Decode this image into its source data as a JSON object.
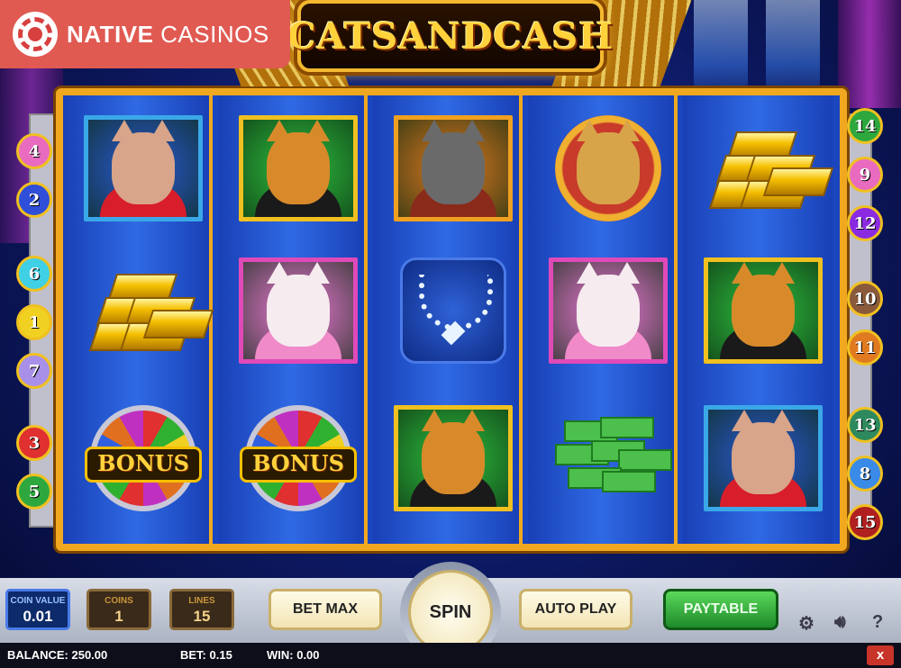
{
  "brand": {
    "prefix": "NATIVE",
    "suffix": "CASINOS"
  },
  "game_title": "CATSANDCASH",
  "reels": [
    {
      "symbols": [
        "cat-lady-red-dress",
        "gold-bars",
        "bonus-wheel"
      ]
    },
    {
      "symbols": [
        "tabby-cat-suit",
        "white-persian-cat",
        "bonus-wheel"
      ]
    },
    {
      "symbols": [
        "grey-cat-dj",
        "diamond-necklace",
        "tabby-cat-suit"
      ]
    },
    {
      "symbols": [
        "singer-cat-medallion",
        "white-persian-cat",
        "cash-stack"
      ]
    },
    {
      "symbols": [
        "gold-bars",
        "tabby-cat-suit",
        "cat-lady-red-dress"
      ]
    }
  ],
  "bonus_label": "BONUS",
  "paylines_left": [
    {
      "n": "4",
      "color": "#e96bbf"
    },
    {
      "n": "2",
      "color": "#2f4fd8"
    },
    {
      "n": "6",
      "color": "#3fd0e6"
    },
    {
      "n": "1",
      "color": "#f0d020"
    },
    {
      "n": "7",
      "color": "#a890e8"
    },
    {
      "n": "3",
      "color": "#e03030"
    },
    {
      "n": "5",
      "color": "#2ea83e"
    }
  ],
  "paylines_right": [
    {
      "n": "14",
      "color": "#2ea83e"
    },
    {
      "n": "9",
      "color": "#e96bbf"
    },
    {
      "n": "12",
      "color": "#8a2be2"
    },
    {
      "n": "10",
      "color": "#8a5a3a"
    },
    {
      "n": "11",
      "color": "#e07a20"
    },
    {
      "n": "13",
      "color": "#2e8a5e"
    },
    {
      "n": "8",
      "color": "#3a8ae8"
    },
    {
      "n": "15",
      "color": "#b02020"
    }
  ],
  "controls": {
    "coin_value": {
      "label": "COIN VALUE",
      "value": "0.01"
    },
    "coins": {
      "label": "COINS",
      "value": "1"
    },
    "lines": {
      "label": "LINES",
      "value": "15"
    },
    "bet_max": "BET MAX",
    "spin": "SPIN",
    "auto_play": "AUTO PLAY",
    "paytable": "PAYTABLE",
    "help": "?",
    "close": "x"
  },
  "status": {
    "balance": "BALANCE: 250.00",
    "bet": "BET: 0.15",
    "win": "WIN: 0.00"
  },
  "colors": {
    "frame_gold": "#f0a820",
    "reel_blue": "#1f4fcf",
    "brand_red": "#e05a52",
    "paytable_green": "#2ea83e"
  }
}
